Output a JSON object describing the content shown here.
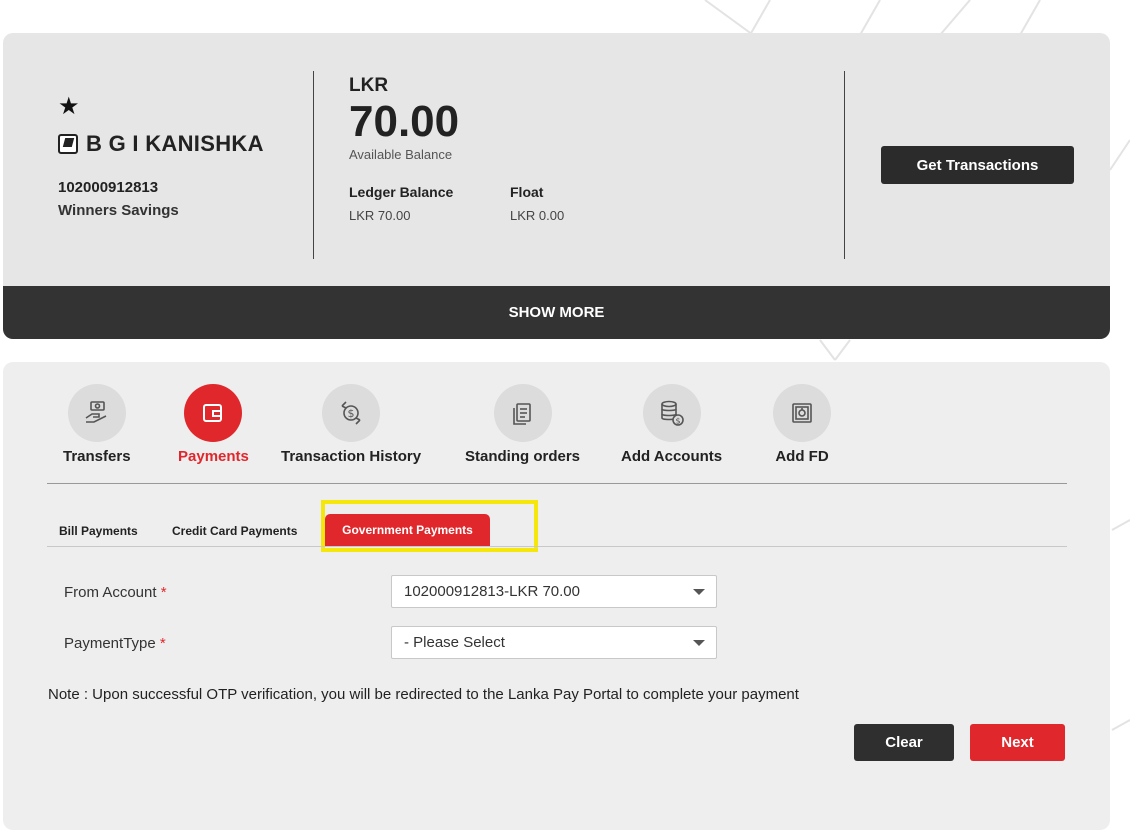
{
  "account": {
    "name": "B G I KANISHKA",
    "number": "102000912813",
    "type": "Winners Savings",
    "currency": "LKR",
    "balance": "70.00",
    "balance_label": "Available Balance",
    "ledger_label": "Ledger Balance",
    "ledger_value": "LKR 70.00",
    "float_label": "Float",
    "float_value": "LKR 0.00",
    "get_transactions_label": "Get Transactions",
    "show_more_label": "SHOW MORE"
  },
  "nav": {
    "items": [
      {
        "label": "Transfers",
        "icon": "money-transfer-icon"
      },
      {
        "label": "Payments",
        "icon": "wallet-icon"
      },
      {
        "label": "Transaction History",
        "icon": "dollar-exchange-icon"
      },
      {
        "label": "Standing orders",
        "icon": "document-icon"
      },
      {
        "label": "Add Accounts",
        "icon": "coin-stack-icon"
      },
      {
        "label": "Add FD",
        "icon": "safe-icon"
      }
    ],
    "active": "Payments"
  },
  "subtabs": {
    "items": [
      "Bill Payments",
      "Credit Card Payments",
      "Government Payments"
    ],
    "active": "Government Payments"
  },
  "form": {
    "from_account_label": "From Account",
    "from_account_value": "102000912813-LKR 70.00",
    "payment_type_label": "PaymentType",
    "payment_type_value": "- Please Select",
    "required_mark": "*"
  },
  "note": "Note : Upon successful OTP verification, you will be redirected to the Lanka Pay Portal to complete your payment",
  "actions": {
    "clear_label": "Clear",
    "next_label": "Next"
  },
  "colors": {
    "accent": "#e0282c",
    "dark": "#2b2b2b",
    "highlight": "#f5e60c"
  }
}
